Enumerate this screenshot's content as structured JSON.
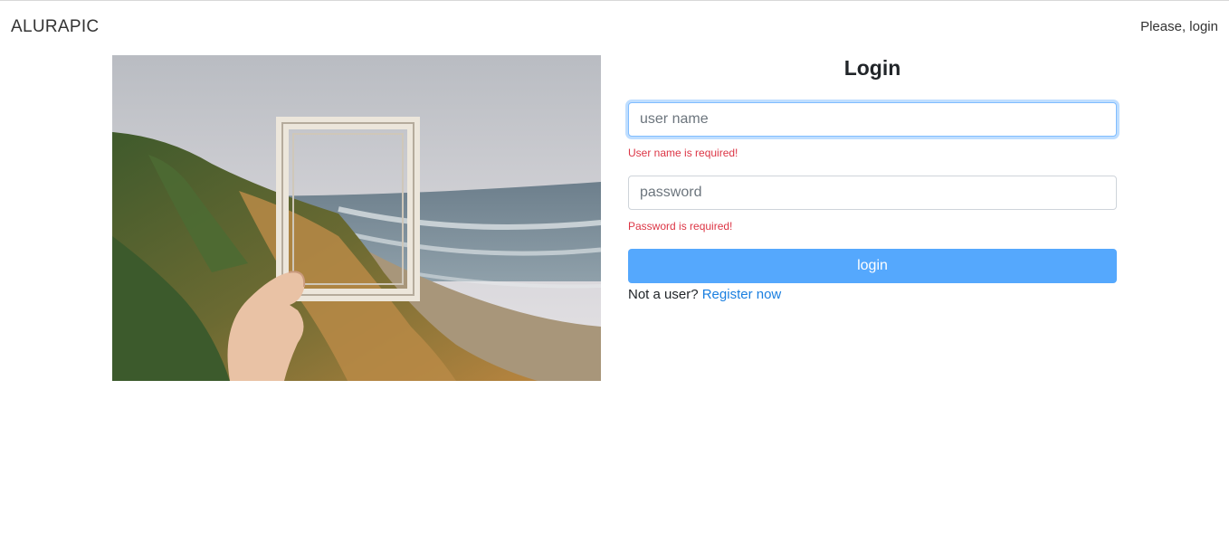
{
  "header": {
    "brand": "ALURAPIC",
    "user_text": "Please, login"
  },
  "login": {
    "title": "Login",
    "username_placeholder": "user name",
    "username_value": "",
    "username_error": "User name is required!",
    "password_placeholder": "password",
    "password_value": "",
    "password_error": "Password is required!",
    "submit_label": "login",
    "signup_prompt": "Not a user?",
    "signup_link": "Register now"
  },
  "colors": {
    "primary_button": "#55a8fd",
    "error_text": "#dc3545",
    "link": "#1a7fe0"
  }
}
